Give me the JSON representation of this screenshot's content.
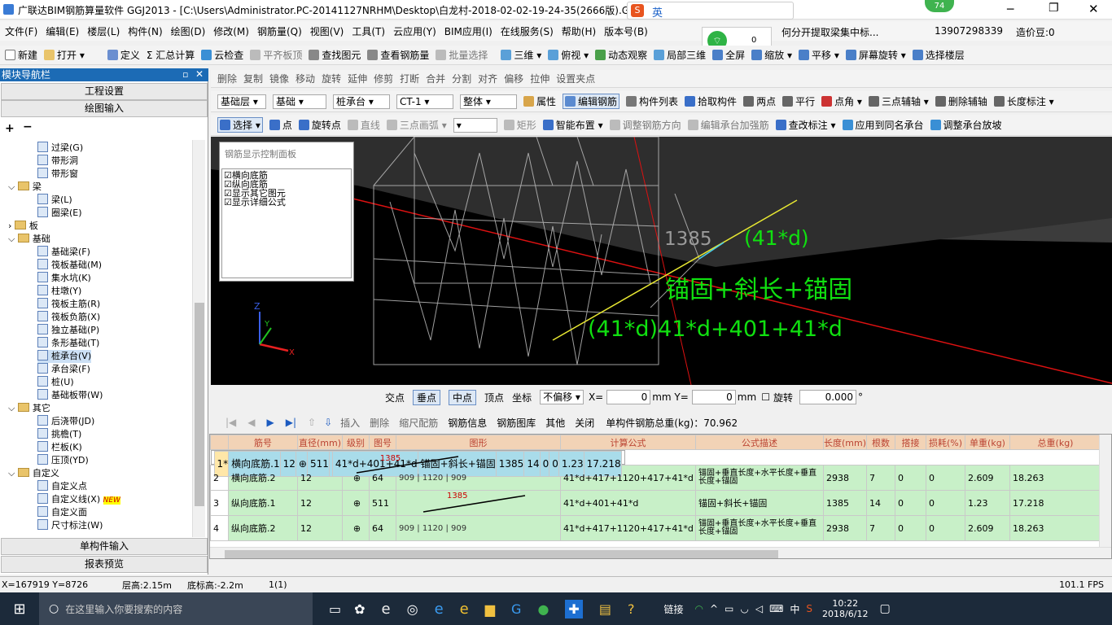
{
  "title": {
    "app_name": "广联达BIM钢筋算量软件 GGJ2013 - [C:\\Users\\Administrator.PC-20141127NRHM\\Desktop\\白龙村-2018-02-02-19-24-35(2666版).GGJ12]",
    "badge": "74",
    "wifi_count": "0"
  },
  "menu": [
    "文件(F)",
    "编辑(E)",
    "楼层(L)",
    "构件(N)",
    "绘图(D)",
    "修改(M)",
    "钢筋量(Q)",
    "视图(V)",
    "工具(T)",
    "云应用(Y)",
    "BIM应用(I)",
    "在线服务(S)",
    "帮助(H)",
    "版本号(B)"
  ],
  "menu_right": {
    "notice": "何分开提取梁集中标...",
    "phone": "13907298339",
    "price": "造价豆:0"
  },
  "toolbar1": [
    "新建",
    "打开",
    "定义",
    "Σ 汇总计算",
    "云检查",
    "平齐板顶",
    "查找图元",
    "查看钢筋量",
    "批量选择",
    "三维",
    "俯视",
    "动态观察",
    "局部三维",
    "全屏",
    "缩放",
    "平移",
    "屏幕旋转",
    "选择楼层"
  ],
  "toolbar2": [
    "删除",
    "复制",
    "镜像",
    "移动",
    "旋转",
    "延伸",
    "修剪",
    "打断",
    "合并",
    "分割",
    "对齐",
    "偏移",
    "拉伸",
    "设置夹点"
  ],
  "toolbar3": {
    "floor": "基础层",
    "category": "基础",
    "type": "桩承台",
    "element": "CT-1",
    "scope": "整体",
    "items": [
      "属性",
      "编辑钢筋",
      "构件列表",
      "拾取构件",
      "两点",
      "平行",
      "点角",
      "三点辅轴",
      "删除辅轴",
      "长度标注"
    ]
  },
  "toolbar4": [
    "选择",
    "点",
    "旋转点",
    "直线",
    "三点画弧",
    "矩形",
    "智能布置",
    "调整钢筋方向",
    "编辑承台加强筋",
    "查改标注",
    "应用到同名承台",
    "调整承台放坡"
  ],
  "nav": {
    "header": "模块导航栏",
    "btn_project": "工程设置",
    "btn_draw": "绘图输入",
    "btn_single": "单构件输入",
    "btn_report": "报表预览",
    "tree": [
      "过梁(G)",
      "带形洞",
      "带形窗",
      "梁",
      "梁(L)",
      "圈梁(E)",
      "板",
      "基础",
      "基础梁(F)",
      "筏板基础(M)",
      "集水坑(K)",
      "柱墩(Y)",
      "筏板主筋(R)",
      "筏板负筋(X)",
      "独立基础(P)",
      "条形基础(T)",
      "桩承台(V)",
      "承台梁(F)",
      "桩(U)",
      "基础板带(W)",
      "其它",
      "后浇带(JD)",
      "挑檐(T)",
      "栏板(K)",
      "压顶(YD)",
      "自定义",
      "自定义点",
      "自定义线(X)",
      "自定义面",
      "尺寸标注(W)"
    ],
    "new_badge": "NEW"
  },
  "panel": {
    "title": "钢筋显示控制面板",
    "checks": [
      "横向底筋",
      "纵向底筋",
      "显示其它图元",
      "显示详细公式"
    ]
  },
  "viewport": {
    "dim": "1385",
    "formula1": "(41*d)",
    "formula2": "锚固+斜长+锚固",
    "formula3": "(41*d)41*d+401+41*d"
  },
  "snapbar": [
    "交点",
    "垂点",
    "中点",
    "顶点",
    "坐标",
    "不偏移",
    "X=",
    "mm Y=",
    "mm",
    "旋转"
  ],
  "snap_values": {
    "x": "0",
    "y": "0",
    "rot": "0.000",
    "deg": "°"
  },
  "gridbar": {
    "items": [
      "插入",
      "删除",
      "缩尺配筋",
      "钢筋信息",
      "钢筋图库",
      "其他",
      "关闭"
    ],
    "total": "单构件钢筋总重(kg)：70.962"
  },
  "table": {
    "headers": [
      "",
      "筋号",
      "直径(mm)",
      "级别",
      "图号",
      "图形",
      "计算公式",
      "公式描述",
      "长度(mm)",
      "根数",
      "搭接",
      "损耗(%)",
      "单重(kg)",
      "总重(kg)"
    ],
    "rows": [
      [
        "1*",
        "横向底筋.1",
        "12",
        "⊕",
        "511",
        "1385",
        "41*d+401+41*d",
        "锚固+斜长+锚固",
        "1385",
        "14",
        "0",
        "0",
        "1.23",
        "17.218"
      ],
      [
        "2",
        "横向底筋.2",
        "12",
        "⊕",
        "64",
        "909 | 1120 | 909",
        "41*d+417+1120+417+41*d",
        "锚固+垂直长度+水平长度+垂直长度+锚固",
        "2938",
        "7",
        "0",
        "0",
        "2.609",
        "18.263"
      ],
      [
        "3",
        "纵向底筋.1",
        "12",
        "⊕",
        "511",
        "1385",
        "41*d+401+41*d",
        "锚固+斜长+锚固",
        "1385",
        "14",
        "0",
        "0",
        "1.23",
        "17.218"
      ],
      [
        "4",
        "纵向底筋.2",
        "12",
        "⊕",
        "64",
        "909 | 1120 | 909",
        "41*d+417+1120+417+41*d",
        "锚固+垂直长度+水平长度+垂直长度+锚固",
        "2938",
        "7",
        "0",
        "0",
        "2.609",
        "18.263"
      ]
    ]
  },
  "status": {
    "coords": "X=167919 Y=8726",
    "floor_h": "层高:2.15m",
    "base_h": "底标高:-2.2m",
    "count": "1(1)",
    "fps": "101.1 FPS"
  },
  "taskbar": {
    "search": "在这里输入你要搜索的内容",
    "link": "链接",
    "lang": "中",
    "time": "10:22",
    "date": "2018/6/12"
  }
}
